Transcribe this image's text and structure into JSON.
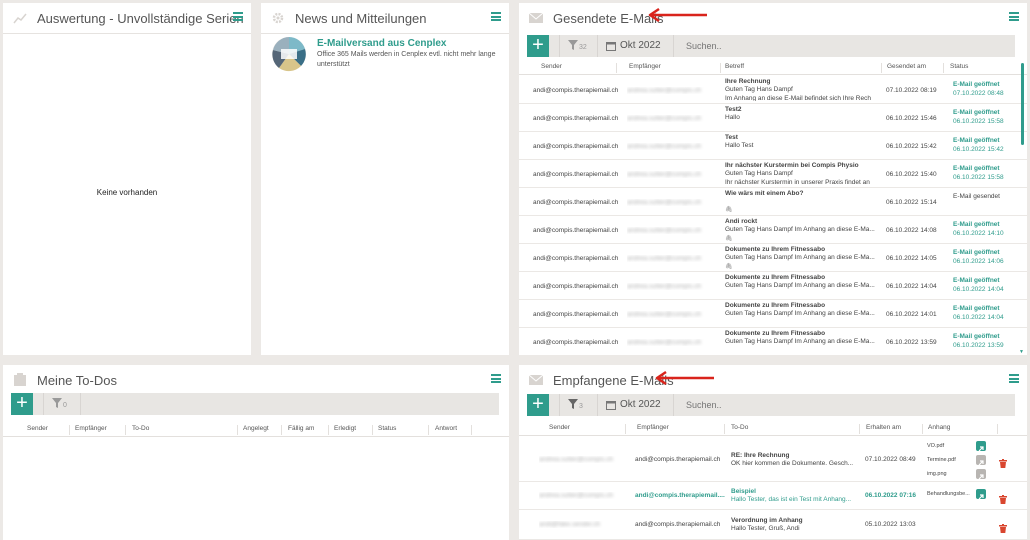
{
  "auswertung": {
    "title": "Auswertung - Unvollständige Serien",
    "empty": "Keine vorhanden"
  },
  "news": {
    "title": "News und Mitteilungen",
    "item_title": "E-Mailversand aus Cenplex",
    "item_text": "Office 365 Mails werden in Cenplex evtl. nicht mehr lange unterstützt"
  },
  "sent": {
    "title": "Gesendete E-Mails",
    "filter_count": "32",
    "date_label": "Okt 2022",
    "search_placeholder": "Suchen..",
    "columns": [
      "Sender",
      "Empfänger",
      "Betreff",
      "Gesendet am",
      "Status"
    ],
    "rows": [
      {
        "sender": "andi@compis.therapiemail.ch",
        "recipient": "andrea.sutter@compis.ch",
        "subject": "Ihre Rechnung",
        "line2": "Guten Tag Hans Dampf",
        "line3": "Im Anhang an diese E-Mail befindet sich Ihre Rech",
        "date": "07.10.2022 08:19",
        "status": "E-Mail geöffnet",
        "status_date": "07.10.2022 08:48"
      },
      {
        "sender": "andi@compis.therapiemail.ch",
        "recipient": "andrea.sutter@compis.ch",
        "subject": "Test2",
        "line2": "Hallo",
        "line3": "",
        "date": "06.10.2022 15:46",
        "status": "E-Mail geöffnet",
        "status_date": "06.10.2022 15:58"
      },
      {
        "sender": "andi@compis.therapiemail.ch",
        "recipient": "andrea.sutter@compis.ch",
        "subject": "Test",
        "line2": "Hallo Test",
        "line3": "",
        "date": "06.10.2022 15:42",
        "status": "E-Mail geöffnet",
        "status_date": "06.10.2022 15:42"
      },
      {
        "sender": "andi@compis.therapiemail.ch",
        "recipient": "andrea.sutter@compis.ch",
        "subject": "Ihr nächster Kurstermin bei Compis Physio",
        "line2": "Guten Tag Hans Dampf",
        "line3": "Ihr nächster Kurstermin in unserer Praxis findet an",
        "date": "06.10.2022 15:40",
        "status": "E-Mail geöffnet",
        "status_date": "06.10.2022 15:58"
      },
      {
        "sender": "andi@compis.therapiemail.ch",
        "recipient": "andrea.sutter@compis.ch",
        "subject": "Wie wärs mit einem Abo?",
        "line2": "",
        "line3": "",
        "date": "06.10.2022 15:14",
        "status": "E-Mail gesendet",
        "status_date": ""
      },
      {
        "sender": "andi@compis.therapiemail.ch",
        "recipient": "andrea.sutter@compis.ch",
        "subject": "Andi rockt",
        "line2": "Guten Tag Hans Dampf  Im Anhang an diese E-Ma...",
        "line3": "",
        "date": "06.10.2022 14:08",
        "status": "E-Mail geöffnet",
        "status_date": "06.10.2022 14:10"
      },
      {
        "sender": "andi@compis.therapiemail.ch",
        "recipient": "andrea.sutter@compis.ch",
        "subject": "Dokumente zu Ihrem Fitnessabo",
        "line2": "Guten Tag Hans Dampf  Im Anhang an diese E-Ma...",
        "line3": "",
        "date": "06.10.2022 14:05",
        "status": "E-Mail geöffnet",
        "status_date": "06.10.2022 14:06"
      },
      {
        "sender": "andi@compis.therapiemail.ch",
        "recipient": "andrea.sutter@compis.ch",
        "subject": "Dokumente zu Ihrem Fitnessabo",
        "line2": "Guten Tag Hans Dampf  Im Anhang an diese E-Ma...",
        "line3": "",
        "date": "06.10.2022 14:04",
        "status": "E-Mail geöffnet",
        "status_date": "06.10.2022 14:04"
      },
      {
        "sender": "andi@compis.therapiemail.ch",
        "recipient": "andrea.sutter@compis.ch",
        "subject": "Dokumente zu Ihrem Fitnessabo",
        "line2": "Guten Tag Hans Dampf  Im Anhang an diese E-Ma...",
        "line3": "",
        "date": "06.10.2022 14:01",
        "status": "E-Mail geöffnet",
        "status_date": "06.10.2022 14:04"
      },
      {
        "sender": "andi@compis.therapiemail.ch",
        "recipient": "andrea.sutter@compis.ch",
        "subject": "Dokumente zu Ihrem Fitnessabo",
        "line2": "Guten Tag Hans Dampf  Im Anhang an diese E-Ma...",
        "line3": "",
        "date": "06.10.2022 13:59",
        "status": "E-Mail geöffnet",
        "status_date": "06.10.2022 13:59"
      }
    ]
  },
  "todos": {
    "title": "Meine To-Dos",
    "filter_count": "0",
    "columns": [
      "Sender",
      "Empfänger",
      "To-Do",
      "Angelegt",
      "Fällig am",
      "Erledigt",
      "Status",
      "Antwort"
    ]
  },
  "received": {
    "title": "Empfangene E-Mails",
    "filter_count": "3",
    "date_label": "Okt 2022",
    "search_placeholder": "Suchen..",
    "columns": [
      "Sender",
      "Empfänger",
      "To-Do",
      "Erhalten am",
      "Anhang"
    ],
    "rows": [
      {
        "sender": "andrea.sutter@compis.ch",
        "recipient": "andi@compis.therapiemail.ch",
        "subject": "RE: Ihre Rechnung",
        "line2": "OK hier kommen die Dokumente.  Gesch...",
        "date": "07.10.2022 08:49",
        "attachments": [
          "VO.pdf",
          "Termine.pdf",
          "img.png"
        ]
      },
      {
        "sender": "andrea.sutter@compis.ch",
        "recipient": "andi@compis.therapiemail....",
        "subject": "Beispiel",
        "line2": "Hallo Tester,  das ist ein Test mit Anhang...",
        "date": "06.10.2022 07:16",
        "attachments": [
          "Behandlungsbe..."
        ]
      },
      {
        "sender": "andi@fake.sender.ch",
        "recipient": "andi@compis.therapiemail.ch",
        "subject": "Verordnung im Anhang",
        "line2": "Hallo Tester,            Gruß,  Andi",
        "date": "05.10.2022 13:03",
        "attachments": []
      }
    ]
  },
  "colors": {
    "accent": "#2f9c8c",
    "annotation": "#d9241c",
    "delete": "#d9462f"
  }
}
